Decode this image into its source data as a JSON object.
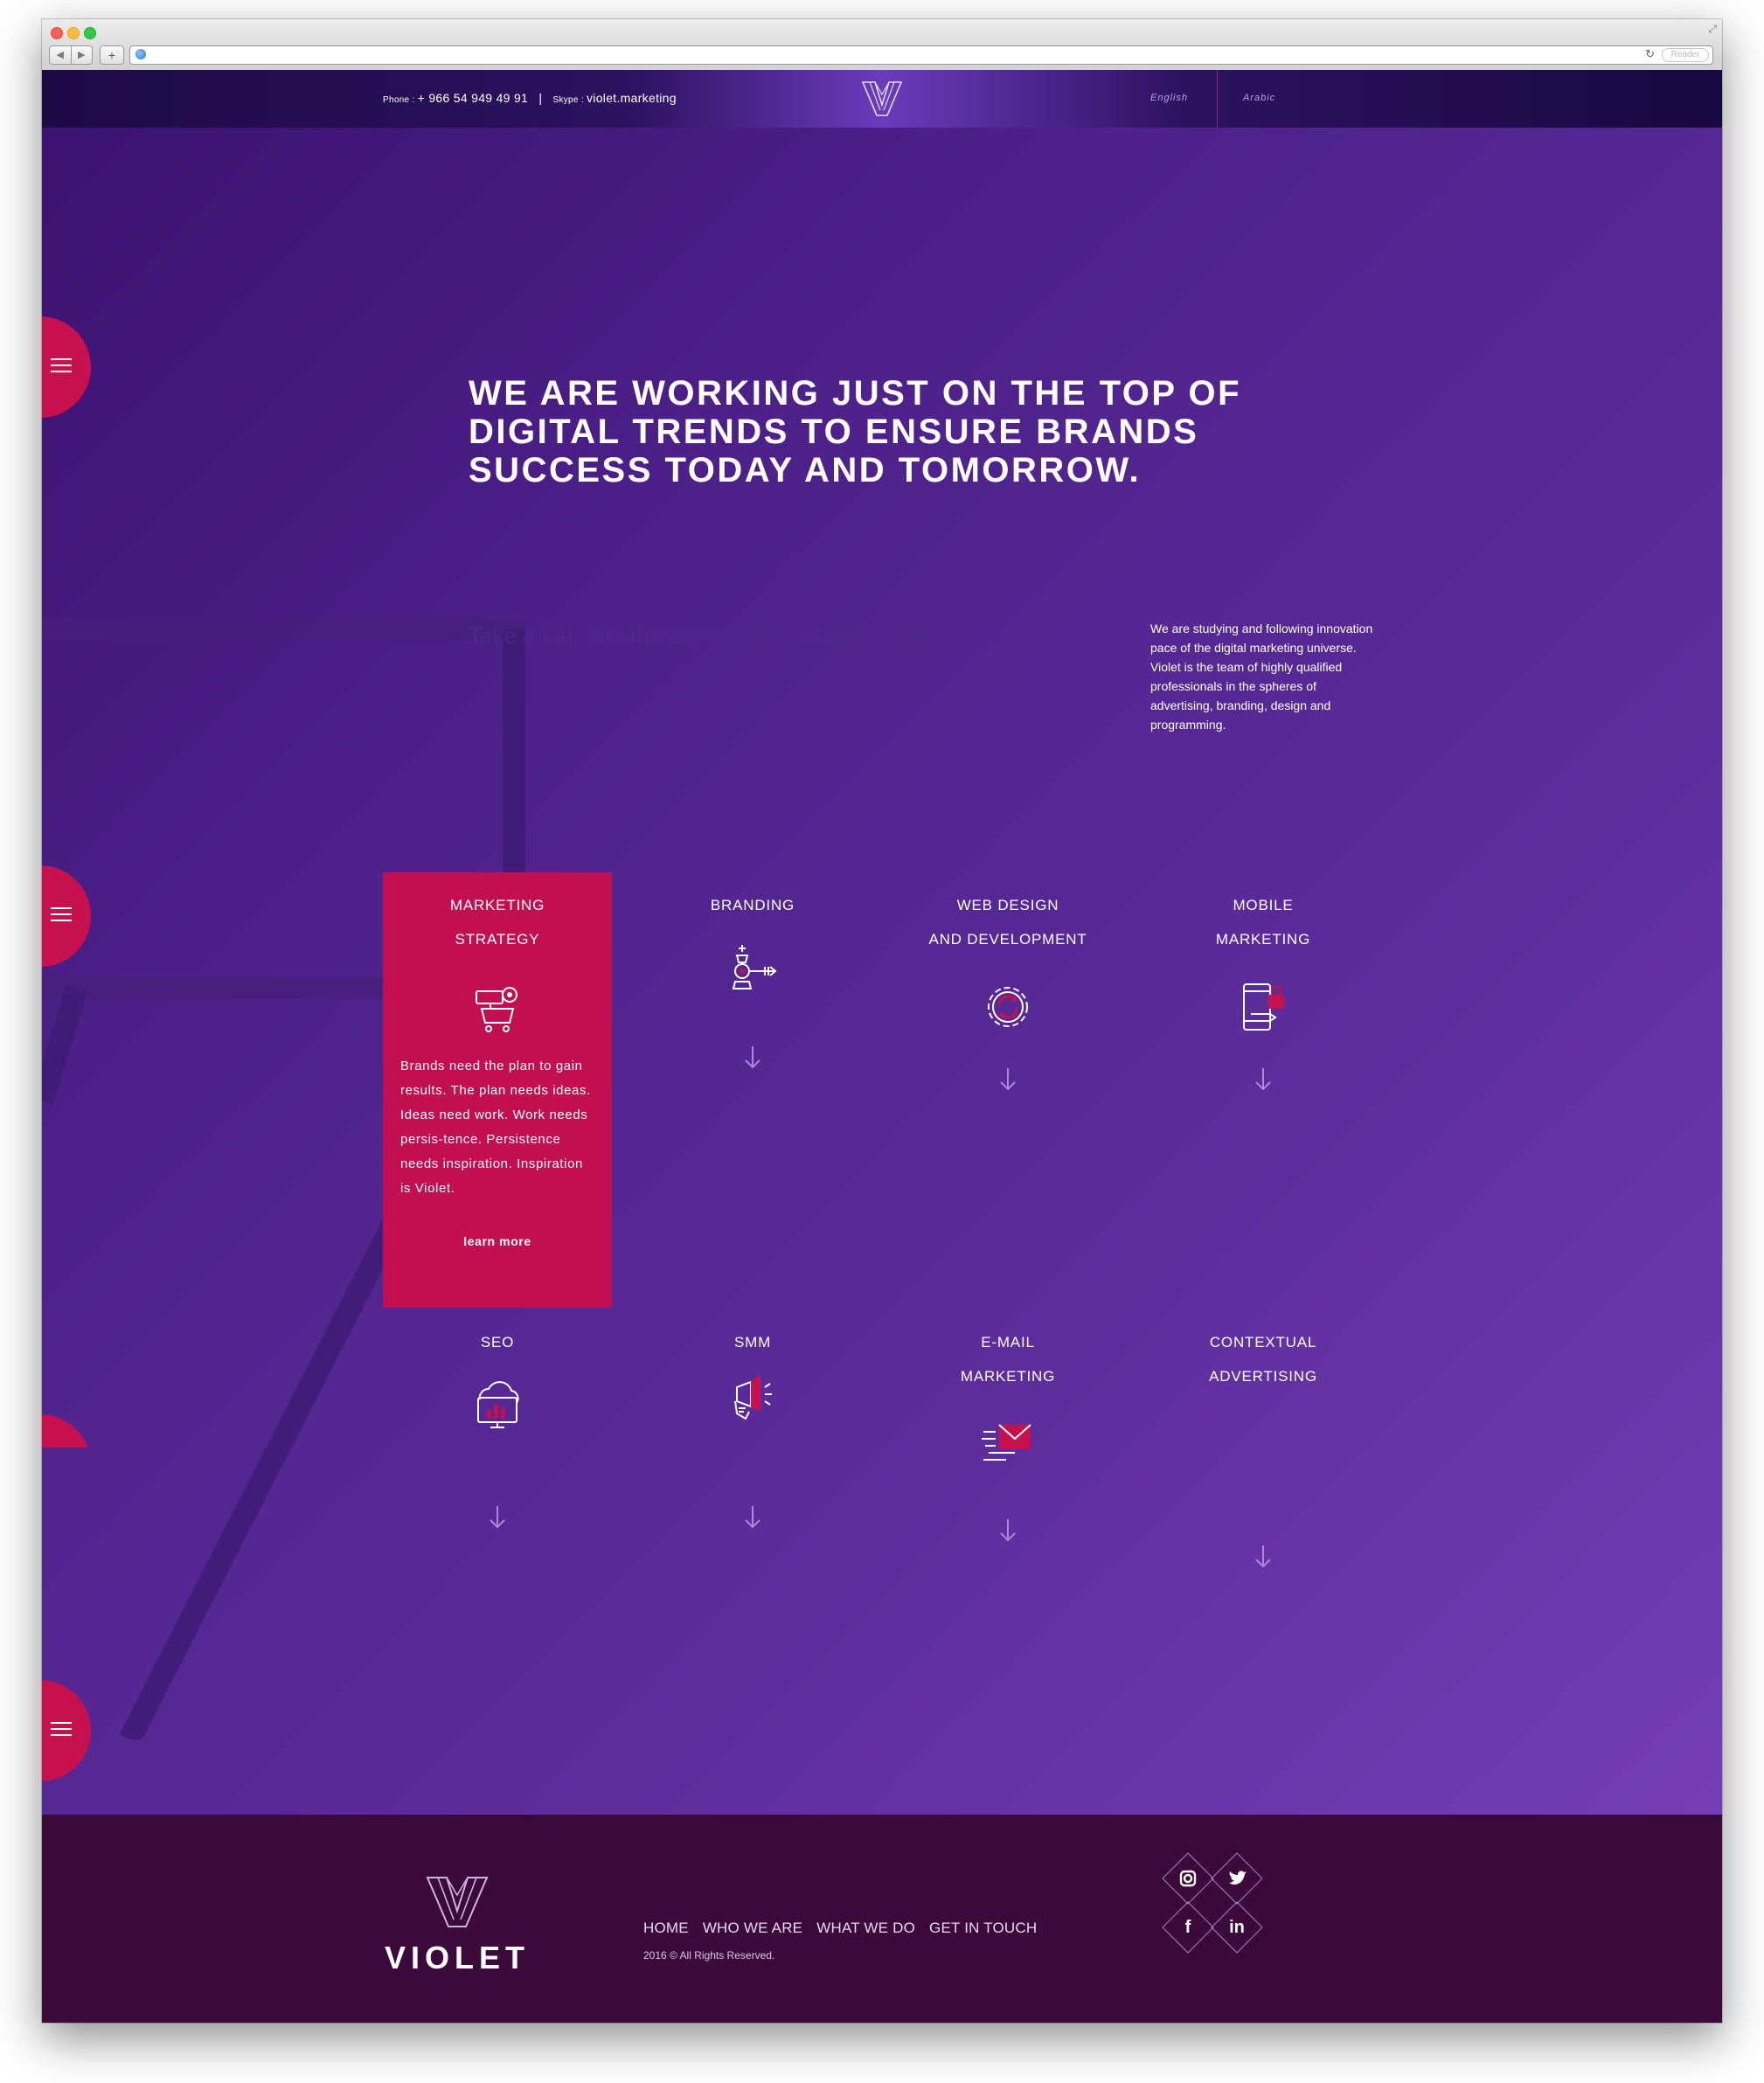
{
  "browser": {
    "nav_back": "◀",
    "nav_forward": "▶",
    "add_tab": "+",
    "reload": "↻",
    "reader": "Reader"
  },
  "header": {
    "phone_label": "Phone : ",
    "phone": "+ 966 54 949 49 91",
    "separator": "|",
    "skype_label": "Skype : ",
    "skype": "violet.marketing",
    "lang_english": "English",
    "lang_arabic": "Arabic"
  },
  "hero": {
    "headline_line1": "WE ARE WORKING JUST ON THE TOP OF",
    "headline_line2": "DIGITAL TRENDS TO ENSURE BRANDS",
    "headline_line3": "SUCCESS TODAY AND TOMORROW.",
    "tour": "Take a tour into the expo of our competencies.",
    "about": "We are studying and following innovation pace of the digital marketing universe. Violet is the team of highly qualified professionals in the spheres of advertising, branding, design and programming."
  },
  "services": [
    {
      "line1": "MARKETING",
      "line2": "STRATEGY",
      "icon": "telescope-cart-icon",
      "active": true,
      "description": "Brands need the plan to gain results. The plan needs ideas. Ideas need work. Work needs persis-tence. Persistence needs inspiration. Inspiration is Violet.",
      "cta": "learn more"
    },
    {
      "line1": "BRANDING",
      "line2": "",
      "icon": "chess-king-arrow-icon"
    },
    {
      "line1": "WEB DESIGN",
      "line2": "AND DEVELOPMENT",
      "icon": "gear-cycle-icon"
    },
    {
      "line1": "MOBILE",
      "line2": "MARKETING",
      "icon": "mobile-lock-icon"
    },
    {
      "line1": "SEO",
      "line2": "",
      "icon": "cloud-monitor-chart-icon"
    },
    {
      "line1": "SMM",
      "line2": "",
      "icon": "megaphone-hand-icon"
    },
    {
      "line1": "E-MAIL",
      "line2": "MARKETING",
      "icon": "envelope-speed-icon"
    },
    {
      "line1": "CONTEXTUAL",
      "line2": "ADVERTISING",
      "icon": ""
    }
  ],
  "footer": {
    "brand": "VIOLET",
    "nav": [
      "HOME",
      "WHO WE ARE",
      "WHAT WE DO",
      "GET IN TOUCH"
    ],
    "copyright": "2016 © All Rights Reserved.",
    "social": [
      "instagram-icon",
      "twitter-icon",
      "facebook-icon",
      "linkedin-icon"
    ]
  },
  "colors": {
    "accent": "#c10f52",
    "footer_bg": "#3b0a3a",
    "hero_gradient_start": "#3b1170",
    "hero_gradient_end": "#7b40bb"
  }
}
